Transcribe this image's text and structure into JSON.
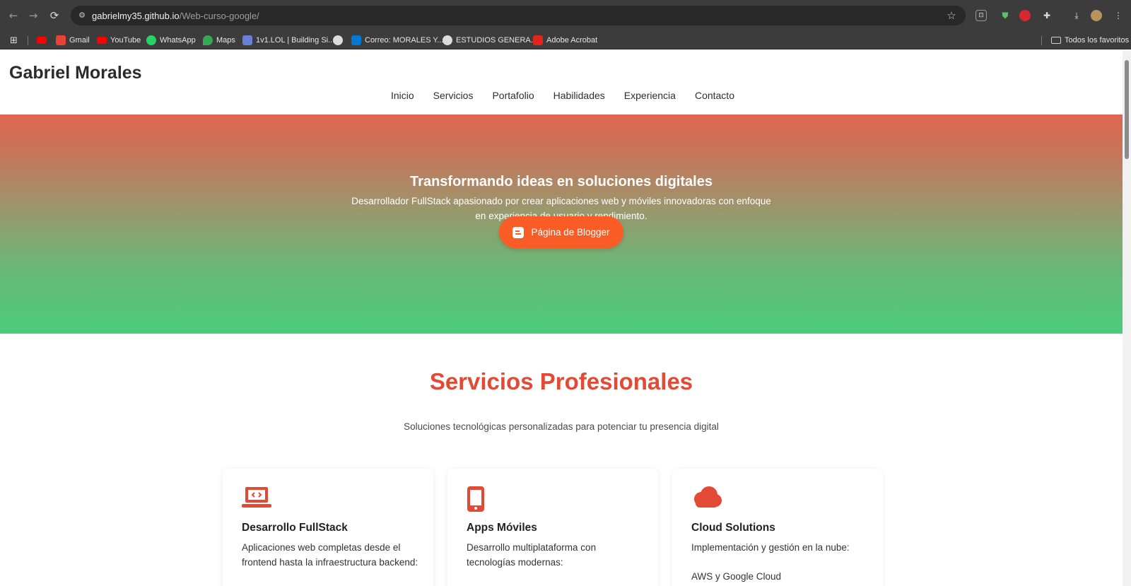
{
  "browser": {
    "url_host": "gabrielmy35.github.io",
    "url_path": "/Web-curso-google/",
    "bookmarks": [
      {
        "label": "",
        "color": "#ff0000"
      },
      {
        "label": "Gmail",
        "color": "#ea4335"
      },
      {
        "label": "YouTube",
        "color": "#ff0000"
      },
      {
        "label": "WhatsApp",
        "color": "#25d366"
      },
      {
        "label": "Maps",
        "color": "#34a853"
      },
      {
        "label": "1v1.LOL | Building Si...",
        "color": "#6a7fd6"
      },
      {
        "label": "",
        "color": "#dcdcdc"
      },
      {
        "label": "Correo: MORALES Y...",
        "color": "#0078d4"
      },
      {
        "label": "ESTUDIOS GENERA...",
        "color": "#dcdcdc"
      },
      {
        "label": "Adobe Acrobat",
        "color": "#e1251b"
      }
    ],
    "favorites_label": "Todos los favoritos"
  },
  "header": {
    "brand": "Gabriel Morales",
    "nav": [
      "Inicio",
      "Servicios",
      "Portafolio",
      "Habilidades",
      "Experiencia",
      "Contacto"
    ]
  },
  "hero": {
    "title": "Transformando ideas en soluciones digitales",
    "subtitle": "Desarrollador FullStack apasionado por crear aplicaciones web y móviles innovadoras con enfoque en experiencia de usuario y rendimiento.",
    "button": "Página de Blogger"
  },
  "services": {
    "title": "Servicios Profesionales",
    "subtitle": "Soluciones tecnológicas personalizadas para potenciar tu presencia digital",
    "cards": [
      {
        "title": "Desarrollo FullStack",
        "text": "Aplicaciones web completas desde el frontend hasta la infraestructura backend:",
        "icon": "laptop-code-icon"
      },
      {
        "title": "Apps Móviles",
        "text": "Desarrollo multiplataforma con tecnologías modernas:",
        "icon": "mobile-icon"
      },
      {
        "title": "Cloud Solutions",
        "text": "Implementación y gestión en la nube:",
        "extra": "AWS y Google Cloud",
        "icon": "cloud-icon"
      }
    ]
  },
  "colors": {
    "accent": "#e34a36",
    "button": "#fa5c25",
    "hero_top": "#df6651",
    "hero_bottom": "#4bcd7b"
  }
}
